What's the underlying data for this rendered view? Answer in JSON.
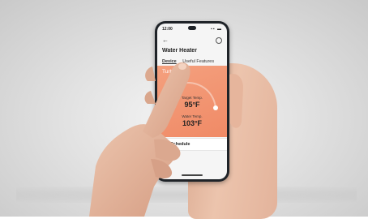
{
  "status_bar": {
    "time": "12:00",
    "indicators": "▪▪ ▬"
  },
  "header": {
    "back_icon": "back-arrow-icon",
    "settings_icon": "gear-icon"
  },
  "title": "Water Heater",
  "tabs": [
    {
      "label": "Device",
      "selected": true
    },
    {
      "label": "Useful Features",
      "selected": false
    }
  ],
  "device_card": {
    "mode_label": "Turbo",
    "target_label": "Target Temp.",
    "target_value": "95°F",
    "water_label": "Water Temp.",
    "water_value": "103°F",
    "accent_color": "#f08a66"
  },
  "schedule": {
    "label": "Schedule"
  }
}
